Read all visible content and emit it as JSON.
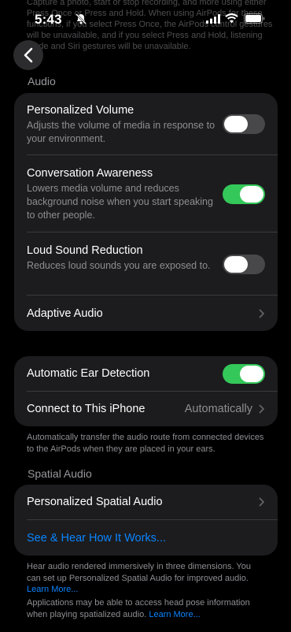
{
  "status": {
    "time": "5:43"
  },
  "background_text": "Capture a photo, start or stop recording, and more using either Press Once or Press and Hold. When using AirPods for these functions, if you select Press Once, the AirPods control gestures will be unavailable, and if you select Press and Hold, listening mode and Siri gestures will be unavailable.",
  "audio": {
    "header": "Audio",
    "rows": [
      {
        "title": "Personalized Volume",
        "subtitle": "Adjusts the volume of media in response to your environment.",
        "on": false
      },
      {
        "title": "Conversation Awareness",
        "subtitle": "Lowers media volume and reduces background noise when you start speaking to other people.",
        "on": true
      },
      {
        "title": "Loud Sound Reduction",
        "subtitle": "Reduces loud sounds you are exposed to.",
        "on": false
      },
      {
        "title": "Adaptive Audio"
      }
    ]
  },
  "ear": {
    "auto_detection": {
      "title": "Automatic Ear Detection",
      "on": true
    },
    "connect": {
      "title": "Connect to This iPhone",
      "value": "Automatically"
    },
    "footer": "Automatically transfer the audio route from connected devices to the AirPods when they are placed in your ears."
  },
  "spatial": {
    "header": "Spatial Audio",
    "personalized": "Personalized Spatial Audio",
    "see_hear": "See & Hear How It Works...",
    "footer1_text": "Hear audio rendered immersively in three dimensions. You can set up Personalized Spatial Audio for improved audio. ",
    "footer1_link": "Learn More...",
    "footer2_text": "Applications may be able to access head pose information when playing spatialized audio. ",
    "footer2_link": "Learn More..."
  },
  "colors": {
    "accent": "#0a84ff",
    "toggle_on": "#34c759",
    "toggle_off": "#48484a",
    "card": "#1c1c1e"
  }
}
